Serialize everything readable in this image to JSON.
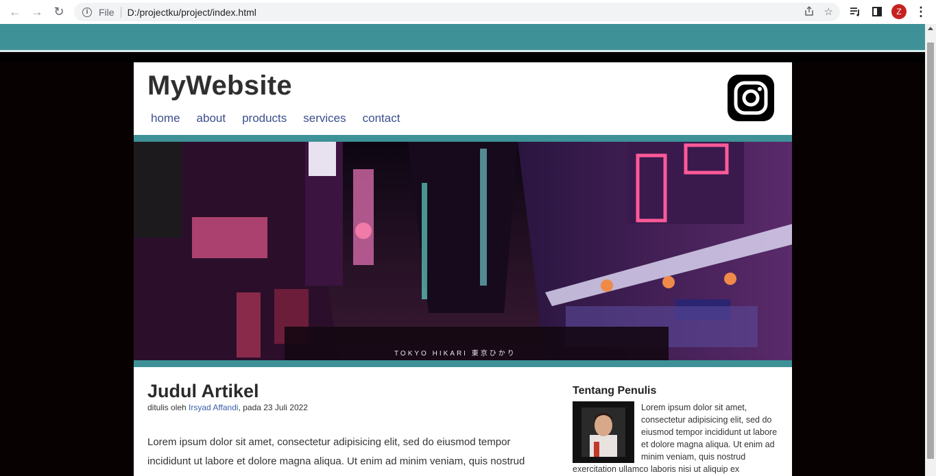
{
  "browser": {
    "scheme_label": "File",
    "url": "D:/projectku/project/index.html",
    "profile_initial": "Z",
    "icons": [
      "back-arrow-icon",
      "forward-arrow-icon",
      "reload-icon",
      "info-icon",
      "share-icon",
      "star-icon",
      "reading-list-icon",
      "side-panel-icon",
      "profile-avatar",
      "more-menu-icon"
    ]
  },
  "site": {
    "title": "MyWebsite",
    "nav": [
      "home",
      "about",
      "products",
      "services",
      "contact"
    ],
    "hero_caption": "TOKYO HIKARI 東京ひかり",
    "colors": {
      "accent": "#3e9197",
      "nav_link": "#3a4e8c"
    }
  },
  "article": {
    "title": "Judul Artikel",
    "byline_prefix": "ditulis oleh ",
    "author": "Irsyad Affandi",
    "byline_suffix": ", pada 23 Juli 2022",
    "body": "Lorem ipsum dolor sit amet, consectetur adipisicing elit, sed do eiusmod tempor incididunt ut labore et dolore magna aliqua. Ut enim ad minim veniam, quis nostrud"
  },
  "aside": {
    "title": "Tentang Penulis",
    "text": "Lorem ipsum dolor sit amet, consectetur adipisicing elit, sed do eiusmod tempor incididunt ut labore et dolore magna aliqua. Ut enim ad minim veniam, quis nostrud exercitation ullamco laboris nisi ut aliquip ex"
  }
}
